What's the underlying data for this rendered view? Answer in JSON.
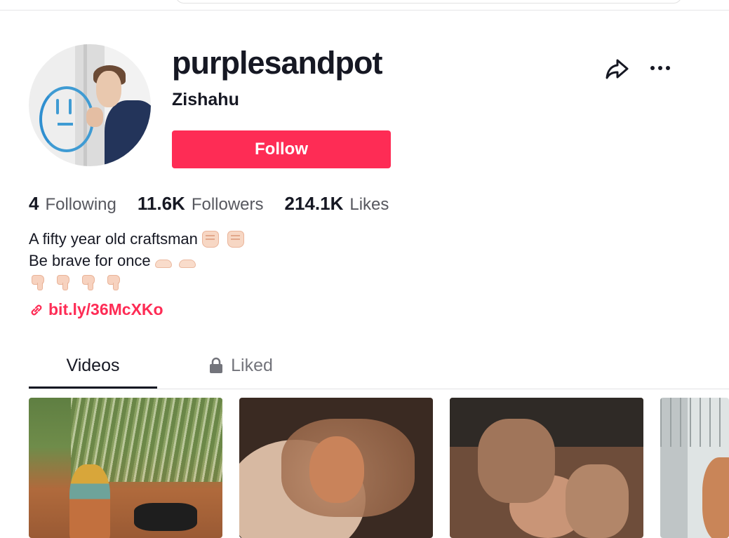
{
  "profile": {
    "username": "purplesandpot",
    "nickname": "Zishahu",
    "follow_label": "Follow"
  },
  "actions": {
    "share_icon": "share-arrow-icon",
    "more_icon": "more-horizontal-icon"
  },
  "stats": [
    {
      "value": "4",
      "label": "Following"
    },
    {
      "value": "11.6K",
      "label": "Followers"
    },
    {
      "value": "214.1K",
      "label": "Likes"
    }
  ],
  "bio": {
    "line1": "A fifty year old craftsman",
    "line2": "Be brave for once",
    "line1_emoji": [
      "✊🏻",
      "✊🏻"
    ],
    "line2_emoji": [
      "👐🏻",
      "👐🏻"
    ],
    "line3_emoji": [
      "👇🏻",
      "👇🏻",
      "👇🏻",
      "👇🏻"
    ],
    "link": "bit.ly/36McXKo"
  },
  "tabs": [
    {
      "label": "Videos",
      "active": true
    },
    {
      "label": "Liked",
      "locked": true
    }
  ],
  "videos_count_visible": 4,
  "colors": {
    "accent": "#fe2c55",
    "text": "#161823",
    "secondary_text": "#57585f"
  }
}
